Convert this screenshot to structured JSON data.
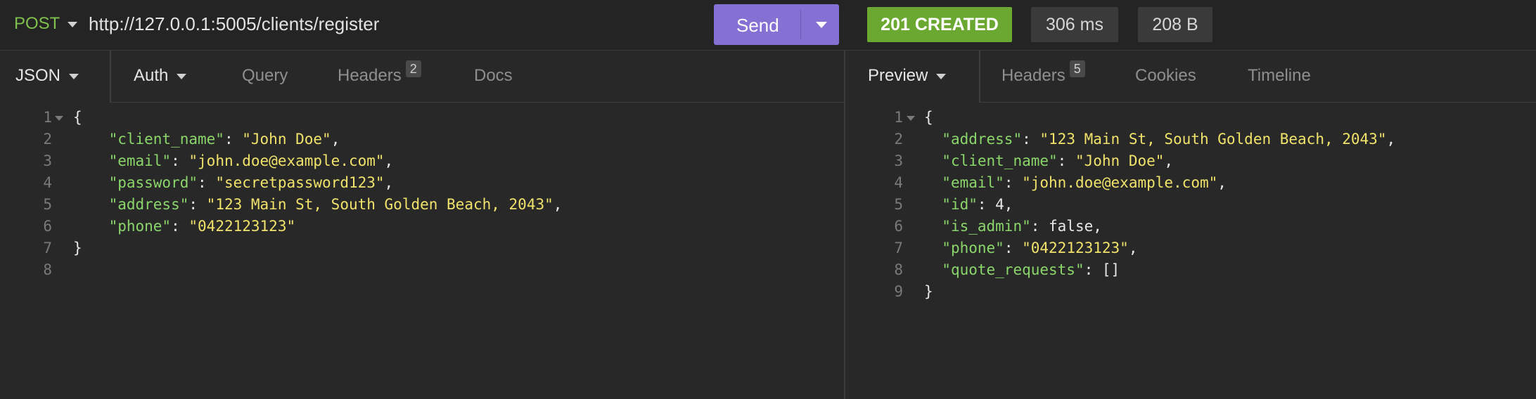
{
  "request": {
    "method": "POST",
    "url": "http://127.0.0.1:5005/clients/register",
    "send_label": "Send"
  },
  "response": {
    "status": "201 CREATED",
    "time": "306 ms",
    "size": "208 B"
  },
  "colors": {
    "method": "#7ec14d",
    "send_button": "#8570d4",
    "status_ok": "#6ba832",
    "json_key": "#8bd66b",
    "json_string": "#f0e26a"
  },
  "request_tabs": [
    {
      "label": "JSON",
      "active": true,
      "dropdown": true
    },
    {
      "label": "Auth",
      "dropdown": true
    },
    {
      "label": "Query"
    },
    {
      "label": "Headers",
      "badge": "2"
    },
    {
      "label": "Docs"
    }
  ],
  "response_tabs": [
    {
      "label": "Preview",
      "active": true,
      "dropdown": true
    },
    {
      "label": "Headers",
      "badge": "5"
    },
    {
      "label": "Cookies"
    },
    {
      "label": "Timeline"
    }
  ],
  "request_body": {
    "lines": [
      [
        {
          "t": "p",
          "v": "{"
        }
      ],
      [
        {
          "t": "p",
          "v": "    "
        },
        {
          "t": "k",
          "v": "\"client_name\""
        },
        {
          "t": "p",
          "v": ": "
        },
        {
          "t": "s",
          "v": "\"John Doe\""
        },
        {
          "t": "p",
          "v": ","
        }
      ],
      [
        {
          "t": "p",
          "v": "    "
        },
        {
          "t": "k",
          "v": "\"email\""
        },
        {
          "t": "p",
          "v": ": "
        },
        {
          "t": "s",
          "v": "\"john.doe@example.com\""
        },
        {
          "t": "p",
          "v": ","
        }
      ],
      [
        {
          "t": "p",
          "v": "    "
        },
        {
          "t": "k",
          "v": "\"password\""
        },
        {
          "t": "p",
          "v": ": "
        },
        {
          "t": "s",
          "v": "\"secretpassword123\""
        },
        {
          "t": "p",
          "v": ","
        }
      ],
      [
        {
          "t": "p",
          "v": "    "
        },
        {
          "t": "k",
          "v": "\"address\""
        },
        {
          "t": "p",
          "v": ": "
        },
        {
          "t": "s",
          "v": "\"123 Main St, South Golden Beach, 2043\""
        },
        {
          "t": "p",
          "v": ","
        }
      ],
      [
        {
          "t": "p",
          "v": "    "
        },
        {
          "t": "k",
          "v": "\"phone\""
        },
        {
          "t": "p",
          "v": ": "
        },
        {
          "t": "s",
          "v": "\"0422123123\""
        }
      ],
      [
        {
          "t": "p",
          "v": "}"
        }
      ],
      []
    ]
  },
  "response_body": {
    "lines": [
      [
        {
          "t": "p",
          "v": "{"
        }
      ],
      [
        {
          "t": "p",
          "v": "  "
        },
        {
          "t": "k",
          "v": "\"address\""
        },
        {
          "t": "p",
          "v": ": "
        },
        {
          "t": "s",
          "v": "\"123 Main St, South Golden Beach, 2043\""
        },
        {
          "t": "p",
          "v": ","
        }
      ],
      [
        {
          "t": "p",
          "v": "  "
        },
        {
          "t": "k",
          "v": "\"client_name\""
        },
        {
          "t": "p",
          "v": ": "
        },
        {
          "t": "s",
          "v": "\"John Doe\""
        },
        {
          "t": "p",
          "v": ","
        }
      ],
      [
        {
          "t": "p",
          "v": "  "
        },
        {
          "t": "k",
          "v": "\"email\""
        },
        {
          "t": "p",
          "v": ": "
        },
        {
          "t": "s",
          "v": "\"john.doe@example.com\""
        },
        {
          "t": "p",
          "v": ","
        }
      ],
      [
        {
          "t": "p",
          "v": "  "
        },
        {
          "t": "k",
          "v": "\"id\""
        },
        {
          "t": "p",
          "v": ": 4,"
        }
      ],
      [
        {
          "t": "p",
          "v": "  "
        },
        {
          "t": "k",
          "v": "\"is_admin\""
        },
        {
          "t": "p",
          "v": ": false,"
        }
      ],
      [
        {
          "t": "p",
          "v": "  "
        },
        {
          "t": "k",
          "v": "\"phone\""
        },
        {
          "t": "p",
          "v": ": "
        },
        {
          "t": "s",
          "v": "\"0422123123\""
        },
        {
          "t": "p",
          "v": ","
        }
      ],
      [
        {
          "t": "p",
          "v": "  "
        },
        {
          "t": "k",
          "v": "\"quote_requests\""
        },
        {
          "t": "p",
          "v": ": []"
        }
      ],
      [
        {
          "t": "p",
          "v": "}"
        }
      ]
    ]
  }
}
